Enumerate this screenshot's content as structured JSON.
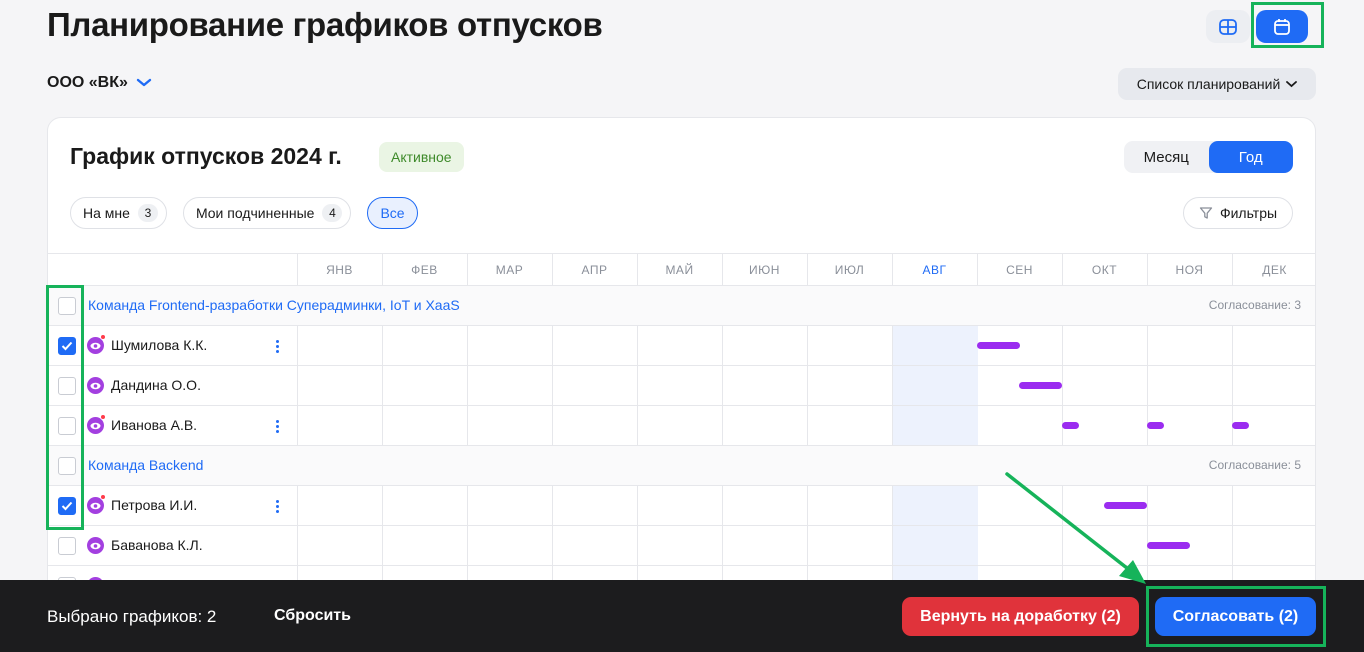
{
  "page": {
    "title": "Планирование графиков отпусков"
  },
  "view_switch": {
    "table_icon": "table-view-icon",
    "calendar_icon": "calendar-icon"
  },
  "org": {
    "name": "ООО «ВК»"
  },
  "plan_list": {
    "label": "Список планирований"
  },
  "schedule": {
    "title": "График отпусков 2024 г.",
    "status": "Активное",
    "period": {
      "month": "Месяц",
      "year": "Год",
      "selected": "Год"
    }
  },
  "chips": [
    {
      "label": "На мне",
      "count": "3"
    },
    {
      "label": "Мои подчиненные",
      "count": "4"
    },
    {
      "label": "Все"
    }
  ],
  "filters_label": "Фильтры",
  "months": [
    "ЯНВ",
    "ФЕВ",
    "МАР",
    "АПР",
    "МАЙ",
    "ИЮН",
    "ИЮЛ",
    "АВГ",
    "СЕН",
    "ОКТ",
    "НОЯ",
    "ДЕК"
  ],
  "current_month": "АВГ",
  "teams": [
    {
      "name": "Команда Frontend-разработки Суперадминки, IoT и XaaS",
      "approvals": "Согласование: 3"
    },
    {
      "name": "Команда Backend",
      "approvals": "Согласование: 5"
    }
  ],
  "employees": [
    {
      "name": "Шумилова К.К.",
      "checked": true
    },
    {
      "name": "Дандина О.О.",
      "checked": false
    },
    {
      "name": "Иванова А.В.",
      "checked": false
    },
    {
      "name": "Петрова И.И.",
      "checked": true
    },
    {
      "name": "Баванова К.Л.",
      "checked": false
    }
  ],
  "bottom_bar": {
    "selected_text": "Выбрано графиков: 2",
    "reset_label": "Сбросить",
    "return_label": "Вернуть на доработку (2)",
    "approve_label": "Согласовать (2)"
  },
  "colors": {
    "accent": "#1f6bf5",
    "vacation_bar": "#9b2cf0",
    "danger": "#e0333b",
    "highlight": "#16b35a"
  }
}
